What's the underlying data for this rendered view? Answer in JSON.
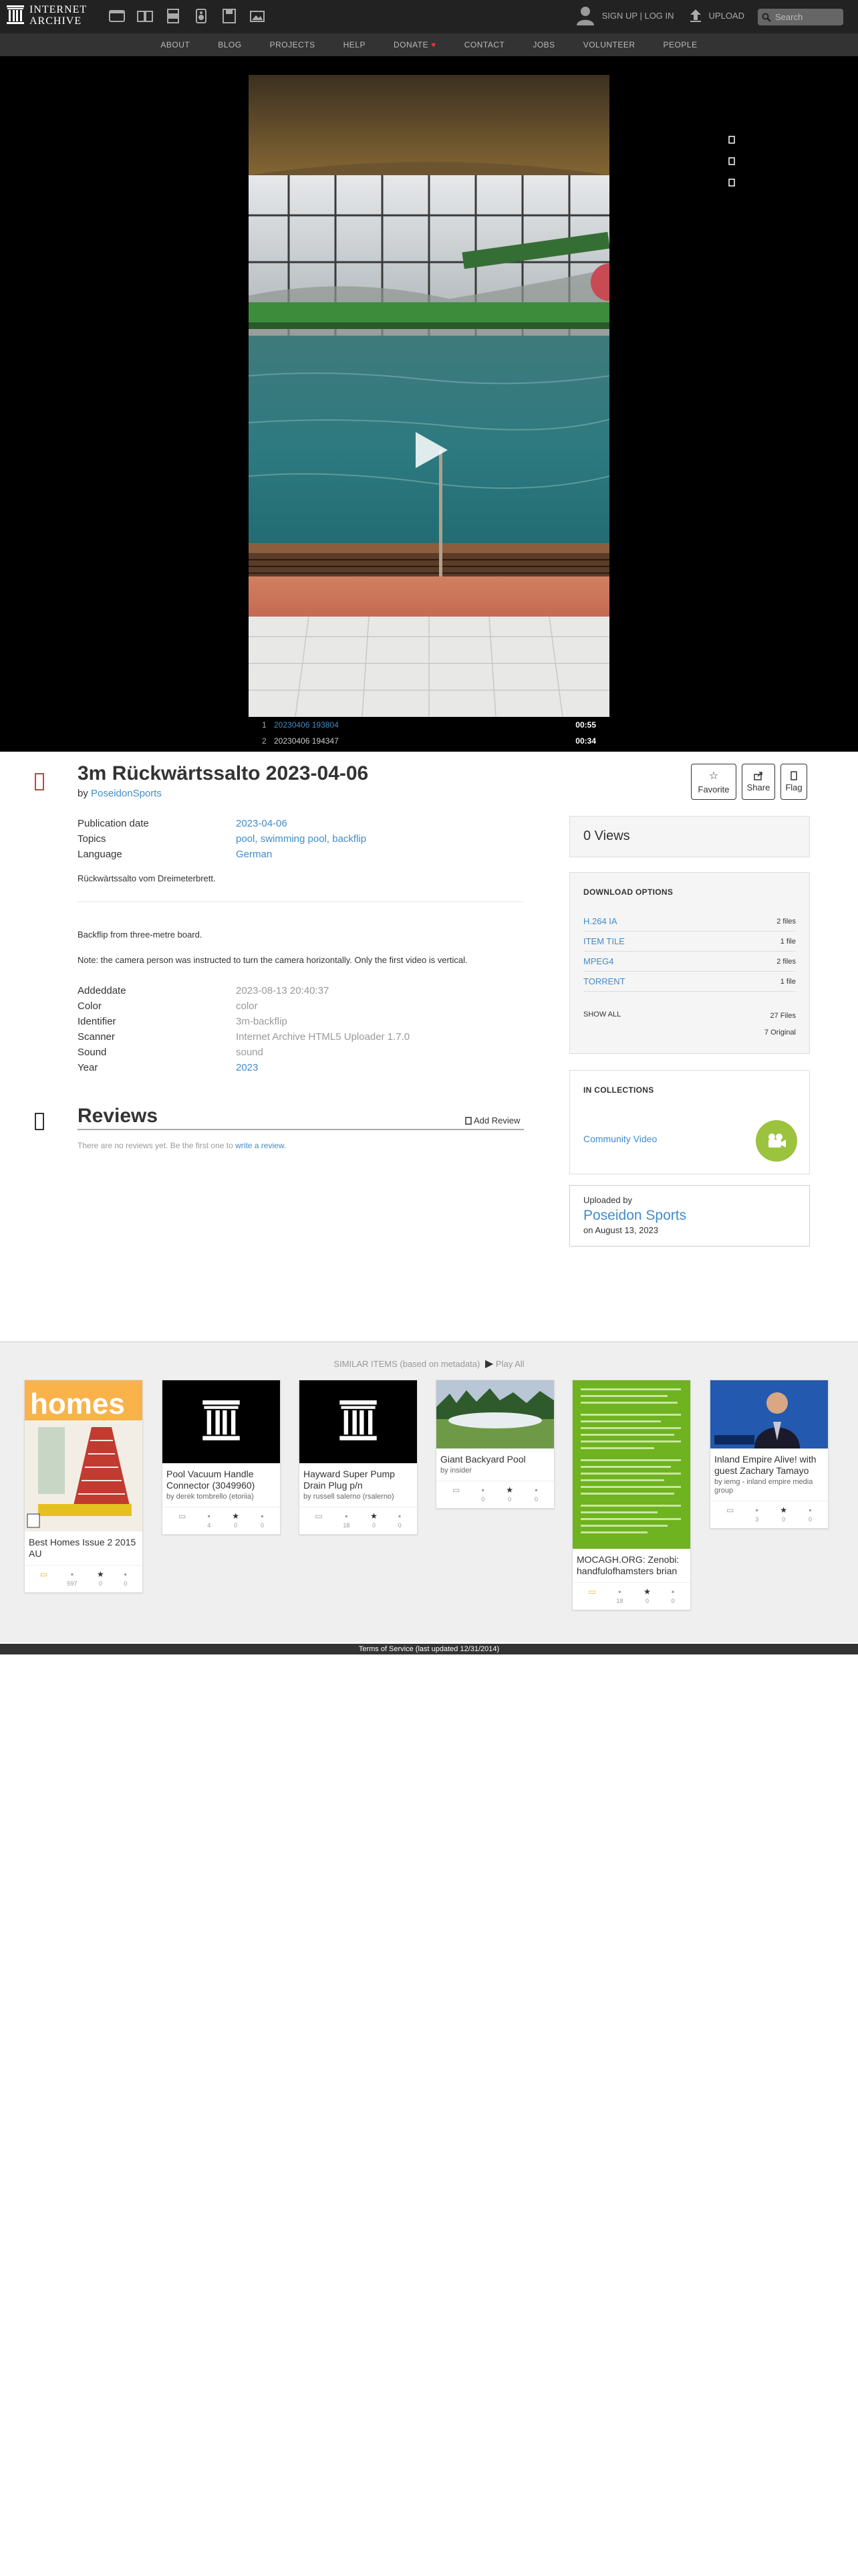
{
  "topbar": {
    "logo_line1": "INTERNET",
    "logo_line2": "ARCHIVE",
    "media_icons": [
      "web-icon",
      "texts-icon",
      "video-icon",
      "audio-icon",
      "software-icon",
      "images-icon"
    ],
    "signup_login": "SIGN UP | LOG IN",
    "upload": "UPLOAD",
    "search_placeholder": "Search"
  },
  "subnav": [
    "ABOUT",
    "BLOG",
    "PROJECTS",
    "HELP",
    "DONATE",
    "CONTACT",
    "JOBS",
    "VOLUNTEER",
    "PEOPLE"
  ],
  "playlist": [
    {
      "num": "1",
      "title": "20230406 193804",
      "duration": "00:55"
    },
    {
      "num": "2",
      "title": "20230406 194347",
      "duration": "00:34"
    }
  ],
  "item": {
    "title": "3m Rückwärtssalto 2023-04-06",
    "by_label": "by",
    "by_name": "PoseidonSports",
    "metadata": [
      {
        "key": "Publication date",
        "value": "2023-04-06"
      },
      {
        "key": "Topics",
        "value": "pool, swimming pool, backflip"
      },
      {
        "key": "Language",
        "value": "German"
      }
    ],
    "description1": "Rückwärtssalto vom Dreimeterbrett.",
    "description2": "Backflip from three-metre board.",
    "description3": "Note: the camera person was instructed to turn the camera horizontally. Only the first video is vertical.",
    "metadata2": [
      {
        "key": "Addeddate",
        "value": "2023-08-13 20:40:37"
      },
      {
        "key": "Color",
        "value": "color"
      },
      {
        "key": "Identifier",
        "value": "3m-backflip"
      },
      {
        "key": "Scanner",
        "value": "Internet Archive HTML5 Uploader 1.7.0"
      },
      {
        "key": "Sound",
        "value": "sound"
      },
      {
        "key": "Year",
        "value": "2023"
      }
    ]
  },
  "actions": {
    "favorite": "Favorite",
    "share": "Share",
    "flag": "Flag"
  },
  "reviews": {
    "title": "Reviews",
    "add": "Add Review",
    "empty": "There are no reviews yet. Be the first one to",
    "write_link": "write a review."
  },
  "views": "0 Views",
  "downloads": {
    "title": "DOWNLOAD OPTIONS",
    "rows": [
      {
        "name": "H.264 IA",
        "count": "2 files"
      },
      {
        "name": "ITEM TILE",
        "count": "1 file"
      },
      {
        "name": "MPEG4",
        "count": "2 files"
      },
      {
        "name": "TORRENT",
        "count": "1 file"
      }
    ],
    "show_all": "SHOW ALL",
    "total_files": "27 Files",
    "original": "7 Original"
  },
  "collections": {
    "title": "IN COLLECTIONS",
    "item": "Community Video"
  },
  "uploader": {
    "label": "Uploaded by",
    "name": "Poseidon Sports",
    "date": "on August 13, 2023"
  },
  "similar": {
    "heading": "SIMILAR ITEMS (based on metadata)",
    "play_all": "Play All",
    "tiles": [
      {
        "title": "Best Homes Issue 2 2015 AU",
        "by": "",
        "stats": [
          "",
          "597",
          "0",
          "0"
        ]
      },
      {
        "title": "Pool Vacuum Handle Connector (3049960)",
        "by": "by derek tombrello (etoriia)",
        "stats": [
          "",
          "4",
          "0",
          "0"
        ]
      },
      {
        "title": "Hayward Super Pump Drain Plug p/n",
        "by": "by russell salerno (rsalerno)",
        "stats": [
          "",
          "18",
          "0",
          "0"
        ]
      },
      {
        "title": "Giant Backyard Pool",
        "by": "by insider",
        "stats": [
          "",
          "0",
          "0",
          "0"
        ]
      },
      {
        "title": "MOCAGH.ORG: Zenobi: handfulofhamsters brian",
        "by": "",
        "stats": [
          "",
          "18",
          "0",
          "0"
        ]
      },
      {
        "title": "Inland Empire Alive! with guest Zachary Tamayo",
        "by": "by iemg - inland empire media group",
        "stats": [
          "",
          "3",
          "0",
          "0"
        ]
      }
    ]
  },
  "footer": "Terms of Service (last updated 12/31/2014)"
}
